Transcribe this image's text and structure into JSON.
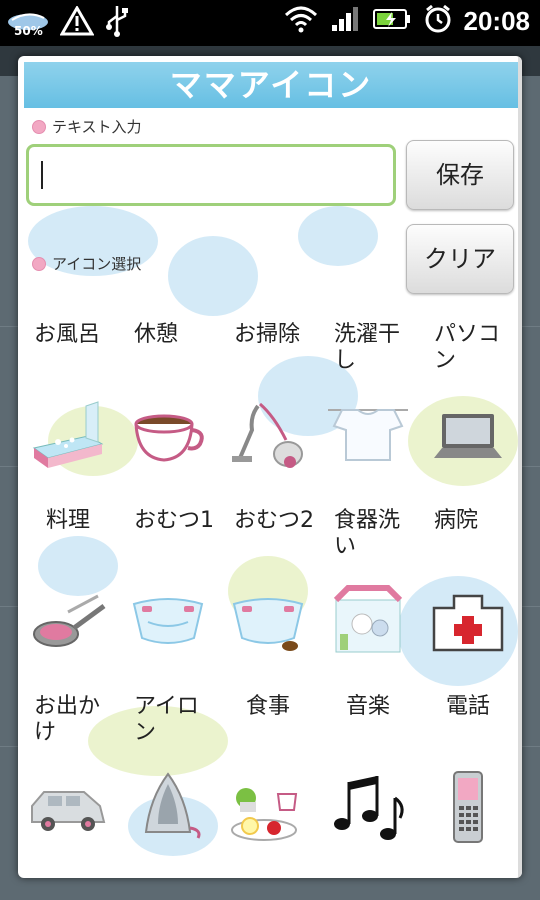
{
  "status_bar": {
    "battery_percent": "50%",
    "time": "20:08"
  },
  "dialog": {
    "title": "ママアイコン",
    "text_input_label": "テキスト入力",
    "text_input_value": "",
    "icon_select_label": "アイコン選択",
    "save_button": "保存",
    "clear_button": "クリア"
  },
  "icons": [
    {
      "label": "お風呂",
      "icon": "bathtub-icon"
    },
    {
      "label": "休憩",
      "icon": "teacup-icon"
    },
    {
      "label": "お掃除",
      "icon": "vacuum-cleaner-icon"
    },
    {
      "label": "洗濯干し",
      "icon": "laundry-shirt-icon"
    },
    {
      "label": "パソコン",
      "icon": "laptop-icon"
    },
    {
      "label": "料理",
      "icon": "frying-pan-icon"
    },
    {
      "label": "おむつ1",
      "icon": "diaper-icon"
    },
    {
      "label": "おむつ2",
      "icon": "diaper-dirty-icon"
    },
    {
      "label": "食器洗い",
      "icon": "dish-washing-icon"
    },
    {
      "label": "病院",
      "icon": "hospital-icon"
    },
    {
      "label": "お出かけ",
      "icon": "car-icon"
    },
    {
      "label": "アイロン",
      "icon": "iron-icon"
    },
    {
      "label": "食事",
      "icon": "meal-icon"
    },
    {
      "label": "音楽",
      "icon": "music-notes-icon"
    },
    {
      "label": "電話",
      "icon": "mobile-phone-icon"
    }
  ]
}
